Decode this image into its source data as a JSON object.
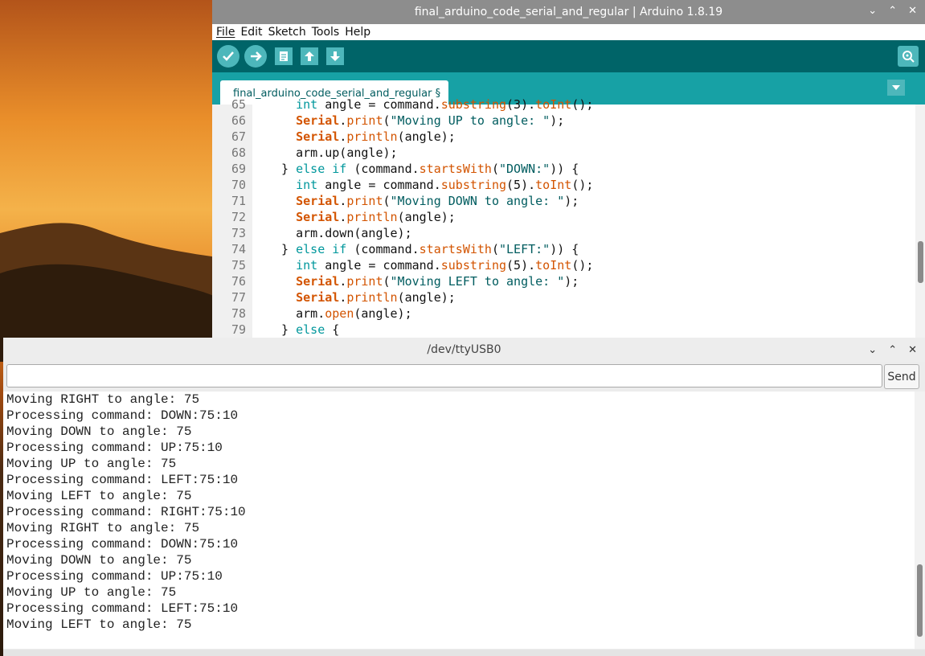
{
  "ide": {
    "title": "final_arduino_code_serial_and_regular | Arduino 1.8.19",
    "menu": [
      "File",
      "Edit",
      "Sketch",
      "Tools",
      "Help"
    ],
    "tab_label": "final_arduino_code_serial_and_regular §",
    "toolbar_icons": [
      "verify-icon",
      "upload-icon",
      "new-icon",
      "open-icon",
      "save-icon",
      "serial-monitor-icon"
    ],
    "code_lines": [
      {
        "n": "65",
        "segments": [
          [
            "",
            "    "
          ],
          [
            "ty",
            "int"
          ],
          [
            "",
            " angle = command."
          ],
          [
            "fn",
            "substring"
          ],
          [
            "",
            "(3)."
          ],
          [
            "fn",
            "toInt"
          ],
          [
            "",
            "();"
          ]
        ]
      },
      {
        "n": "66",
        "segments": [
          [
            "",
            "    "
          ],
          [
            "obj",
            "Serial"
          ],
          [
            "",
            "."
          ],
          [
            "fn",
            "print"
          ],
          [
            "",
            "("
          ],
          [
            "str",
            "\"Moving UP to angle: \""
          ],
          [
            "",
            ");"
          ]
        ]
      },
      {
        "n": "67",
        "segments": [
          [
            "",
            "    "
          ],
          [
            "obj",
            "Serial"
          ],
          [
            "",
            "."
          ],
          [
            "fn",
            "println"
          ],
          [
            "",
            "(angle);"
          ]
        ]
      },
      {
        "n": "68",
        "segments": [
          [
            "",
            "    arm.up(angle);"
          ]
        ]
      },
      {
        "n": "69",
        "segments": [
          [
            "",
            "  } "
          ],
          [
            "kw",
            "else"
          ],
          [
            "",
            " "
          ],
          [
            "kw",
            "if"
          ],
          [
            "",
            " (command."
          ],
          [
            "fn",
            "startsWith"
          ],
          [
            "",
            "("
          ],
          [
            "str",
            "\"DOWN:\""
          ],
          [
            "",
            ")) {"
          ]
        ]
      },
      {
        "n": "70",
        "segments": [
          [
            "",
            "    "
          ],
          [
            "ty",
            "int"
          ],
          [
            "",
            " angle = command."
          ],
          [
            "fn",
            "substring"
          ],
          [
            "",
            "(5)."
          ],
          [
            "fn",
            "toInt"
          ],
          [
            "",
            "();"
          ]
        ]
      },
      {
        "n": "71",
        "segments": [
          [
            "",
            "    "
          ],
          [
            "obj",
            "Serial"
          ],
          [
            "",
            "."
          ],
          [
            "fn",
            "print"
          ],
          [
            "",
            "("
          ],
          [
            "str",
            "\"Moving DOWN to angle: \""
          ],
          [
            "",
            ");"
          ]
        ]
      },
      {
        "n": "72",
        "segments": [
          [
            "",
            "    "
          ],
          [
            "obj",
            "Serial"
          ],
          [
            "",
            "."
          ],
          [
            "fn",
            "println"
          ],
          [
            "",
            "(angle);"
          ]
        ]
      },
      {
        "n": "73",
        "segments": [
          [
            "",
            "    arm.down(angle);"
          ]
        ]
      },
      {
        "n": "74",
        "segments": [
          [
            "",
            "  } "
          ],
          [
            "kw",
            "else"
          ],
          [
            "",
            " "
          ],
          [
            "kw",
            "if"
          ],
          [
            "",
            " (command."
          ],
          [
            "fn",
            "startsWith"
          ],
          [
            "",
            "("
          ],
          [
            "str",
            "\"LEFT:\""
          ],
          [
            "",
            ")) {"
          ]
        ]
      },
      {
        "n": "75",
        "segments": [
          [
            "",
            "    "
          ],
          [
            "ty",
            "int"
          ],
          [
            "",
            " angle = command."
          ],
          [
            "fn",
            "substring"
          ],
          [
            "",
            "(5)."
          ],
          [
            "fn",
            "toInt"
          ],
          [
            "",
            "();"
          ]
        ]
      },
      {
        "n": "76",
        "segments": [
          [
            "",
            "    "
          ],
          [
            "obj",
            "Serial"
          ],
          [
            "",
            "."
          ],
          [
            "fn",
            "print"
          ],
          [
            "",
            "("
          ],
          [
            "str",
            "\"Moving LEFT to angle: \""
          ],
          [
            "",
            ");"
          ]
        ]
      },
      {
        "n": "77",
        "segments": [
          [
            "",
            "    "
          ],
          [
            "obj",
            "Serial"
          ],
          [
            "",
            "."
          ],
          [
            "fn",
            "println"
          ],
          [
            "",
            "(angle);"
          ]
        ]
      },
      {
        "n": "78",
        "segments": [
          [
            "",
            "    arm."
          ],
          [
            "fn",
            "open"
          ],
          [
            "",
            "(angle);"
          ]
        ]
      },
      {
        "n": "79",
        "segments": [
          [
            "",
            "  } "
          ],
          [
            "kw",
            "else"
          ],
          [
            "",
            " {"
          ]
        ]
      }
    ]
  },
  "serial": {
    "title": "/dev/ttyUSB0",
    "input_value": "",
    "send_label": "Send",
    "output": [
      "Moving RIGHT to angle: 75",
      "Processing command: DOWN:75:10",
      "Moving DOWN to angle: 75",
      "Processing command: UP:75:10",
      "Moving UP to angle: 75",
      "Processing command: LEFT:75:10",
      "Moving LEFT to angle: 75",
      "Processing command: RIGHT:75:10",
      "Moving RIGHT to angle: 75",
      "Processing command: DOWN:75:10",
      "Moving DOWN to angle: 75",
      "Processing command: UP:75:10",
      "Moving UP to angle: 75",
      "Processing command: LEFT:75:10",
      "Moving LEFT to angle: 75"
    ]
  },
  "colors": {
    "titlebar": "#8d8d8d",
    "toolbar": "#006468",
    "tabstrip": "#17a1a5",
    "button": "#4db7bb"
  }
}
